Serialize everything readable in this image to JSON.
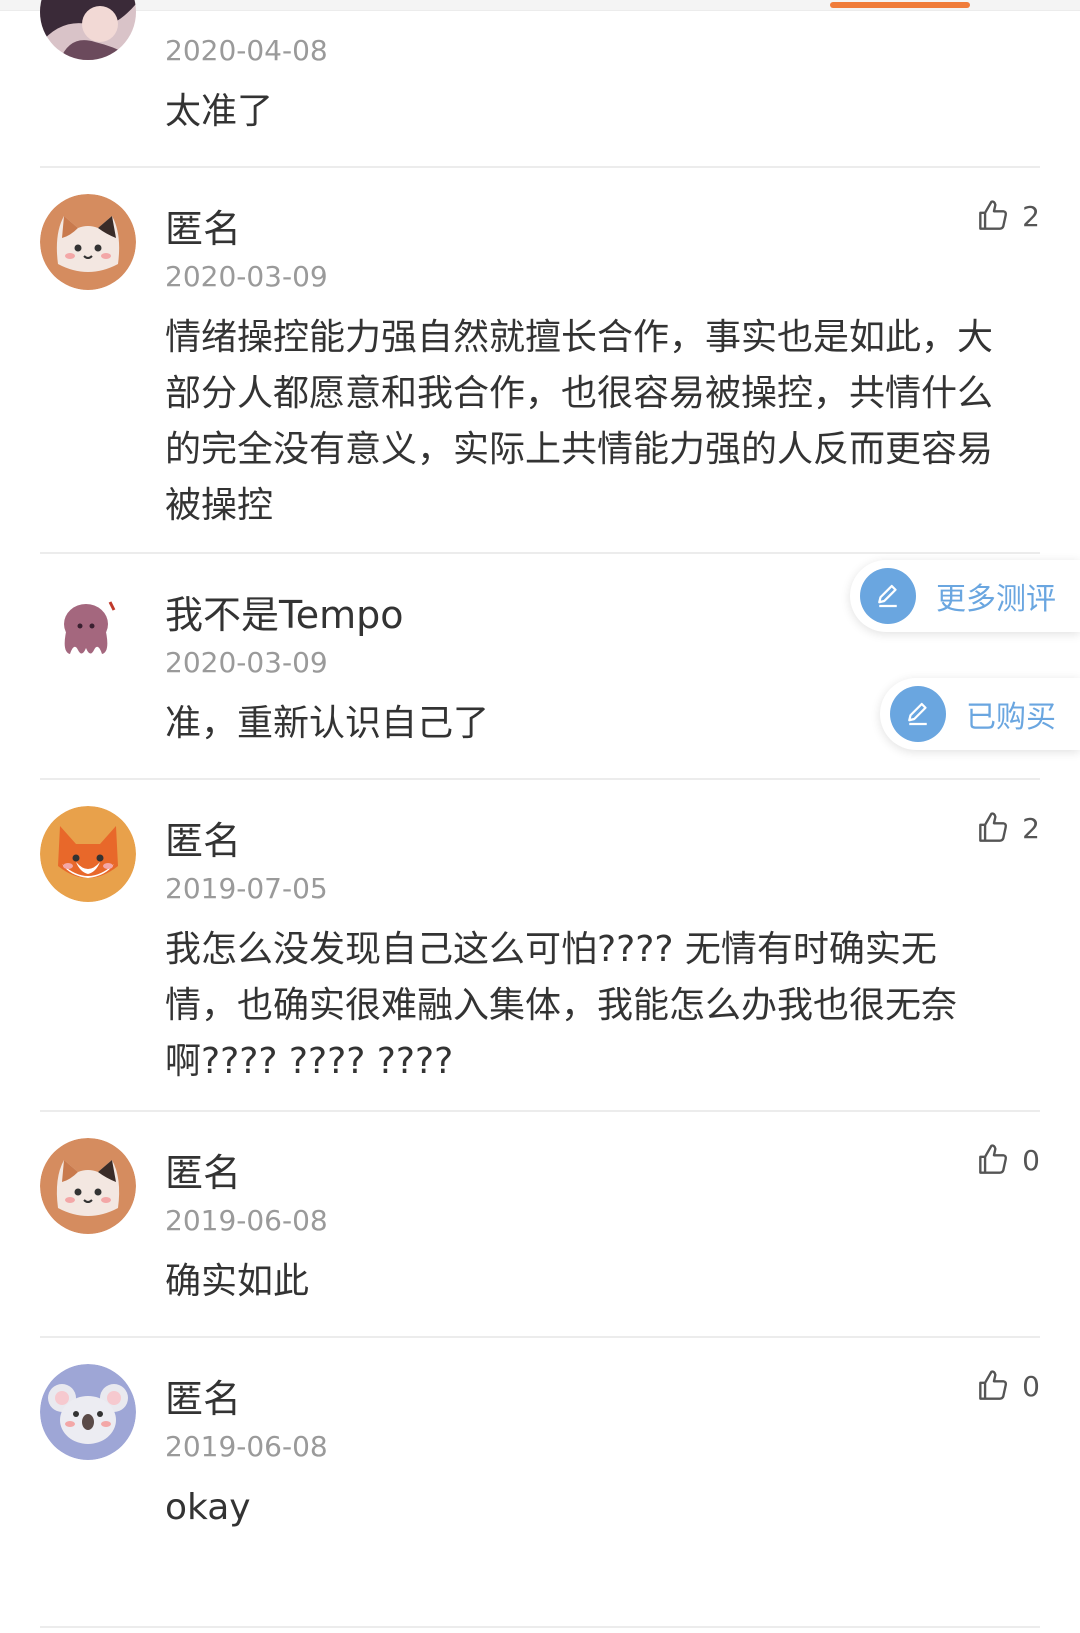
{
  "colors": {
    "accent": "#f07c3a",
    "float_button": "#6aa6e0",
    "divider": "#ececec",
    "date": "#9a9a9a"
  },
  "comments": [
    {
      "avatar": "girl-avatar",
      "name": "",
      "date": "2020-04-08",
      "text": "太准了",
      "likes": null
    },
    {
      "avatar": "cat-avatar",
      "name": "匿名",
      "date": "2020-03-09",
      "text": "情绪操控能力强自然就擅长合作，事实也是如此，大部分人都愿意和我合作，也很容易被操控，共情什么的完全没有意义，实际上共情能力强的人反而更容易被操控",
      "likes": "2"
    },
    {
      "avatar": "octopus-avatar",
      "name": "我不是Tempo",
      "date": "2020-03-09",
      "text": "准，重新认识自己了",
      "likes": null
    },
    {
      "avatar": "fox-avatar",
      "name": "匿名",
      "date": "2019-07-05",
      "text": "我怎么没发现自己这么可怕???? 无情有时确实无情，也确实很难融入集体，我能怎么办我也很无奈啊???? ???? ????",
      "likes": "2"
    },
    {
      "avatar": "cat-avatar",
      "name": "匿名",
      "date": "2019-06-08",
      "text": "确实如此",
      "likes": "0"
    },
    {
      "avatar": "koala-avatar",
      "name": "匿名",
      "date": "2019-06-08",
      "text": "okay",
      "likes": "0"
    }
  ],
  "floating": {
    "more_reviews": "更多测评",
    "purchased": "已购买"
  }
}
